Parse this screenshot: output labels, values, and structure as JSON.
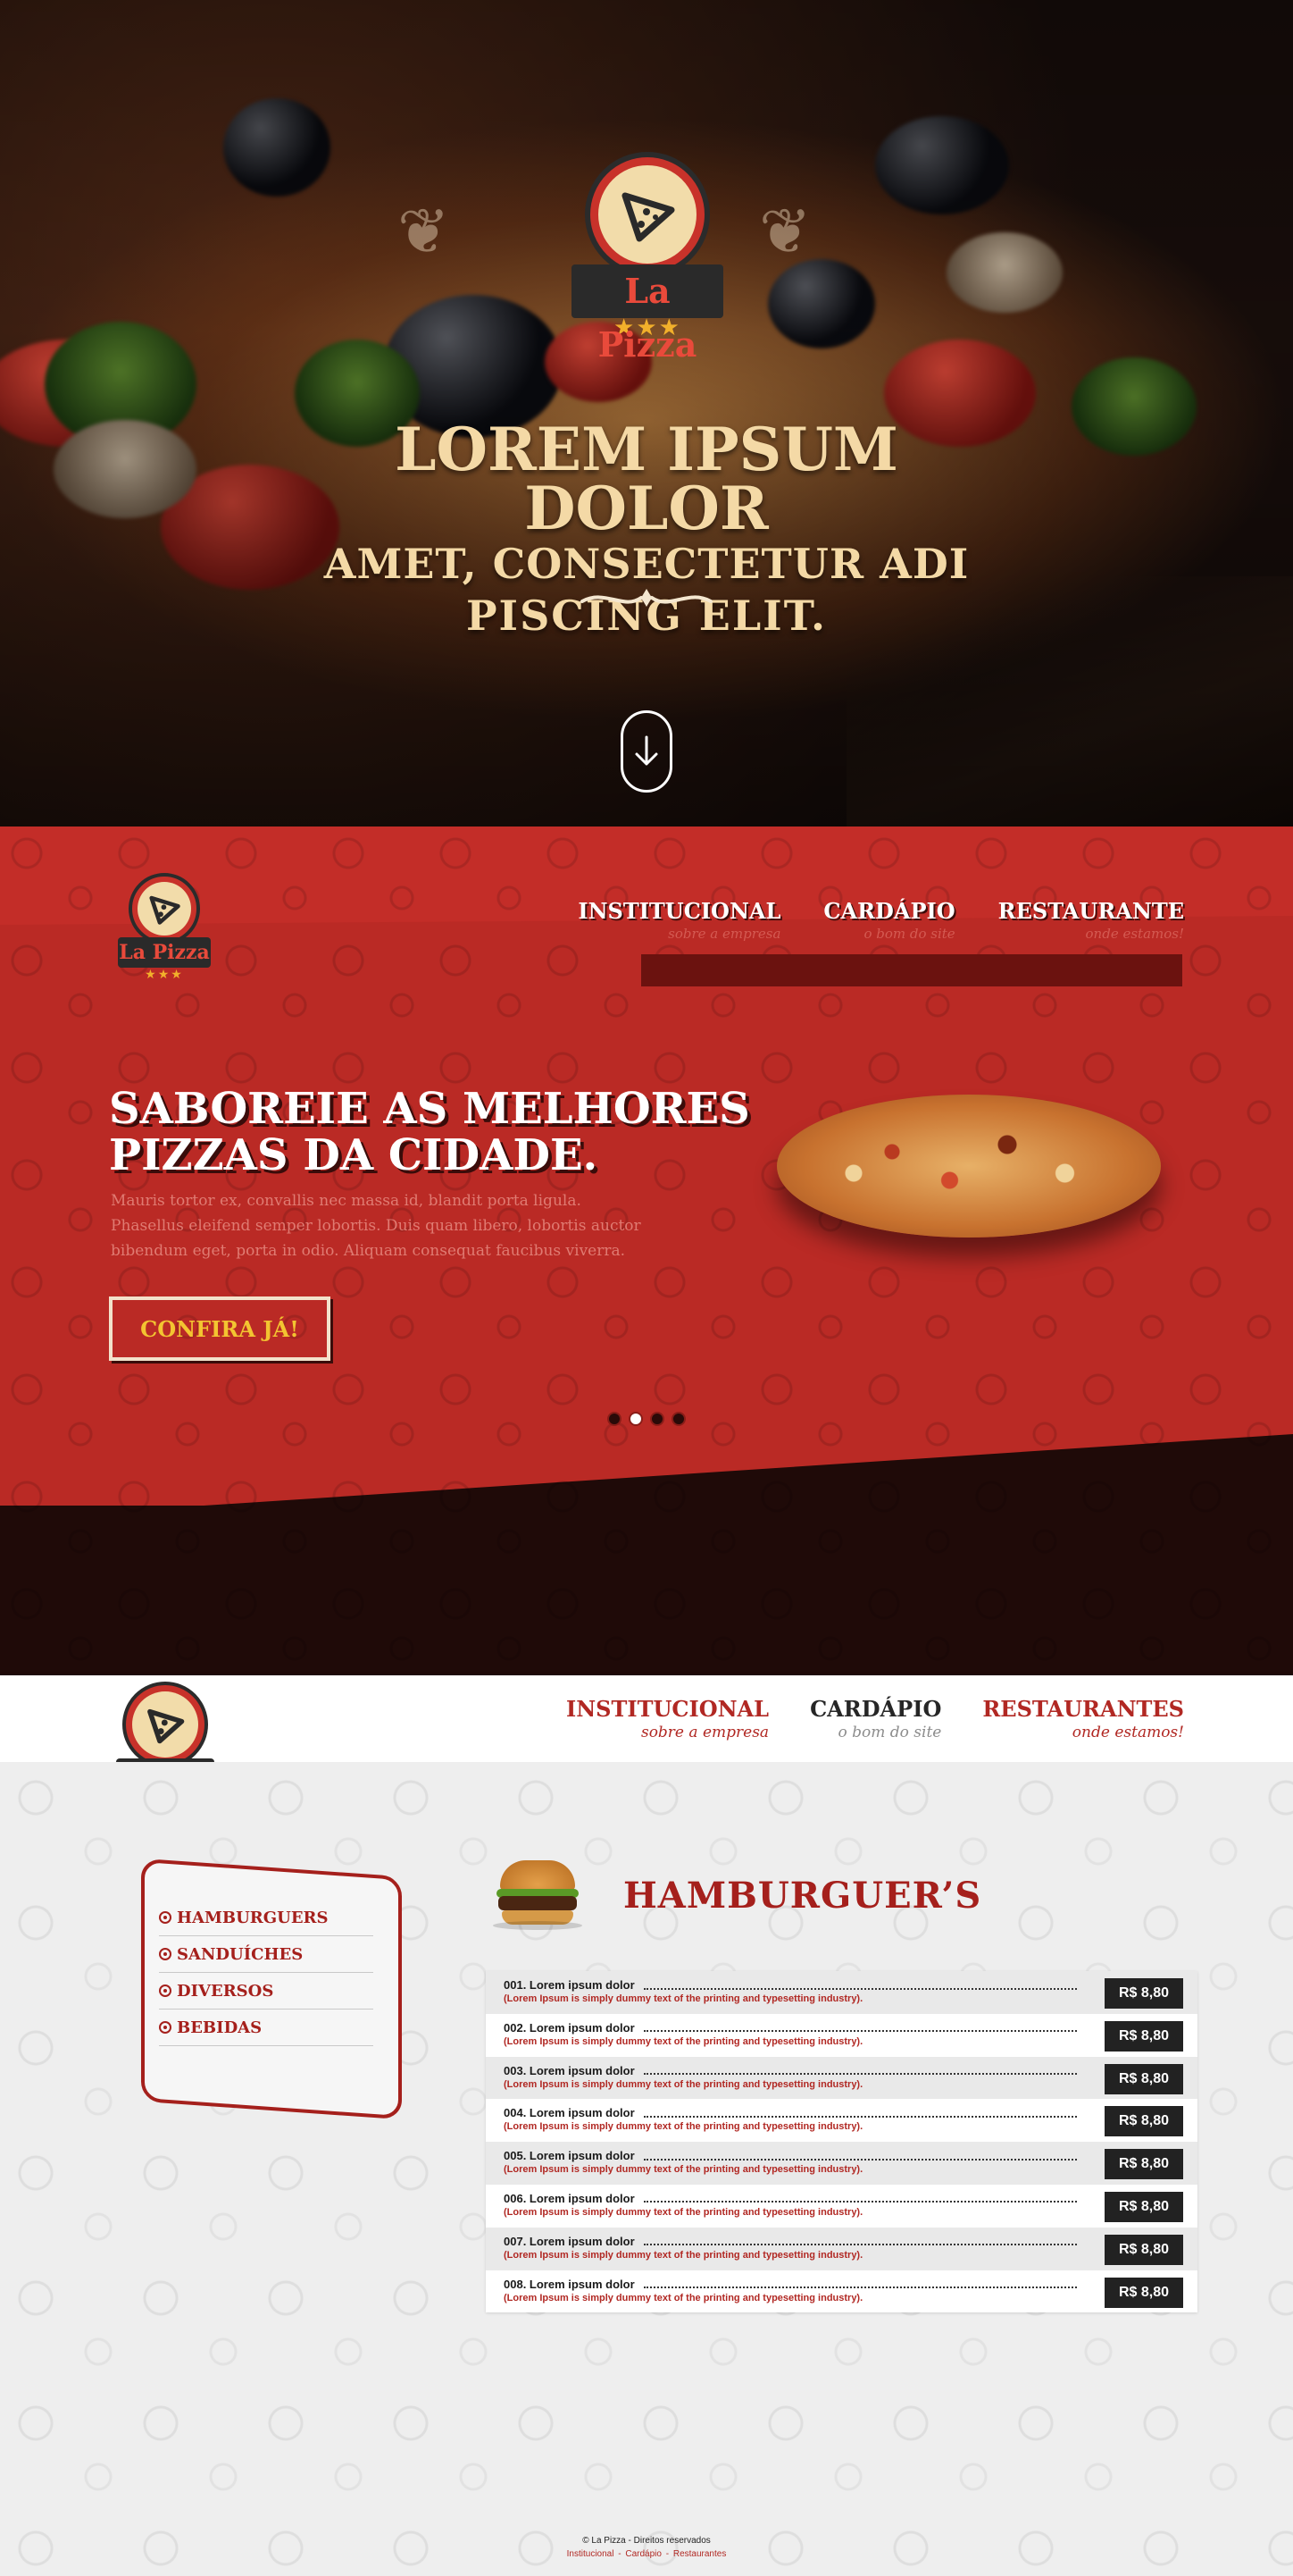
{
  "brand": {
    "logo_text": "La Pizza"
  },
  "hero": {
    "title_line1": "Lorem ipsum dolor",
    "title_line2": "amet, consectetur adi",
    "title_line3": "piscing elit."
  },
  "red_nav": [
    {
      "title": "INSTITUCIONAL",
      "subtitle": "sobre a empresa"
    },
    {
      "title": "CARDÁPIO",
      "subtitle": "o bom do site"
    },
    {
      "title": "RESTAURANTE",
      "subtitle": "onde estamos!"
    }
  ],
  "slider": {
    "title_line1": "Saboreie as melhores",
    "title_line2": "pizzas da cidade.",
    "text": "Mauris tortor ex, convallis nec massa id, blandit porta ligula. Phasellus eleifend semper lobortis. Duis quam libero, lobortis auctor bibendum eget, porta in odio. Aliquam consequat faucibus viverra.",
    "cta": "CONFIRA JÁ!",
    "active_slide": 2,
    "slide_count": 4
  },
  "white_nav": [
    {
      "title": "INSTITUCIONAL",
      "subtitle": "sobre a empresa"
    },
    {
      "title": "CARDÁPIO",
      "subtitle": "o bom do site"
    },
    {
      "title": "RESTAURANTES",
      "subtitle": "onde estamos!"
    }
  ],
  "categories": [
    "HAMBURGUERS",
    "SANDUÍCHES",
    "DIVERSOS",
    "BEBIDAS"
  ],
  "category_title": "HAMBURGUER’S",
  "items": [
    {
      "name": "001. Lorem ipsum dolor",
      "desc": "(Lorem Ipsum is simply dummy text of the printing and typesetting industry).",
      "price": "R$ 8,80"
    },
    {
      "name": "002. Lorem ipsum dolor",
      "desc": "(Lorem Ipsum is simply dummy text of the printing and typesetting industry).",
      "price": "R$ 8,80"
    },
    {
      "name": "003. Lorem ipsum dolor",
      "desc": "(Lorem Ipsum is simply dummy text of the printing and typesetting industry).",
      "price": "R$ 8,80"
    },
    {
      "name": "004. Lorem ipsum dolor",
      "desc": "(Lorem Ipsum is simply dummy text of the printing and typesetting industry).",
      "price": "R$ 8,80"
    },
    {
      "name": "005. Lorem ipsum dolor",
      "desc": "(Lorem Ipsum is simply dummy text of the printing and typesetting industry).",
      "price": "R$ 8,80"
    },
    {
      "name": "006. Lorem ipsum dolor",
      "desc": "(Lorem Ipsum is simply dummy text of the printing and typesetting industry).",
      "price": "R$ 8,80"
    },
    {
      "name": "007. Lorem ipsum dolor",
      "desc": "(Lorem Ipsum is simply dummy text of the printing and typesetting industry).",
      "price": "R$ 8,80"
    },
    {
      "name": "008. Lorem ipsum dolor",
      "desc": "(Lorem Ipsum is simply dummy text of the printing and typesetting industry).",
      "price": "R$ 8,80"
    }
  ],
  "footer": {
    "copyright": "© La Pizza - Direitos reservados",
    "links": [
      "Institucional",
      "Cardápio",
      "Restaurantes"
    ]
  },
  "colors": {
    "brand_red": "#b12823",
    "dark": "#1f0a08",
    "accent_yellow": "#f3c431",
    "cream": "#f4d9a6"
  },
  "icons": [
    "pizza-slice-icon",
    "arrow-down-icon",
    "star-icon",
    "bullet-icon"
  ]
}
